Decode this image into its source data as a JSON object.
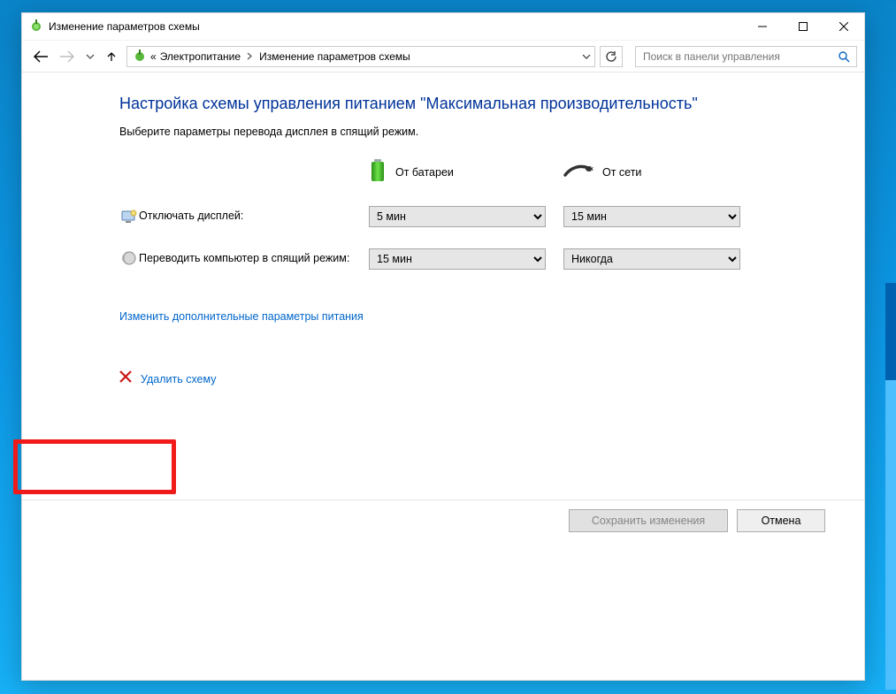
{
  "window": {
    "title": "Изменение параметров схемы"
  },
  "breadcrumb": {
    "root_prefix": "«",
    "item1": "Электропитание",
    "item2": "Изменение параметров схемы"
  },
  "search": {
    "placeholder": "Поиск в панели управления"
  },
  "page": {
    "heading": "Настройка схемы управления питанием \"Максимальная производительность\"",
    "subheading": "Выберите параметры перевода дисплея в спящий режим."
  },
  "cols": {
    "battery": "От батареи",
    "plugged": "От сети"
  },
  "rows": {
    "display_off": {
      "label": "Отключать дисплей:",
      "battery_value": "5 мин",
      "plugged_value": "15 мин"
    },
    "sleep": {
      "label": "Переводить компьютер в спящий режим:",
      "battery_value": "15 мин",
      "plugged_value": "Никогда"
    }
  },
  "links": {
    "advanced": "Изменить дополнительные параметры питания",
    "delete": "Удалить схему"
  },
  "buttons": {
    "save": "Сохранить изменения",
    "cancel": "Отмена"
  }
}
